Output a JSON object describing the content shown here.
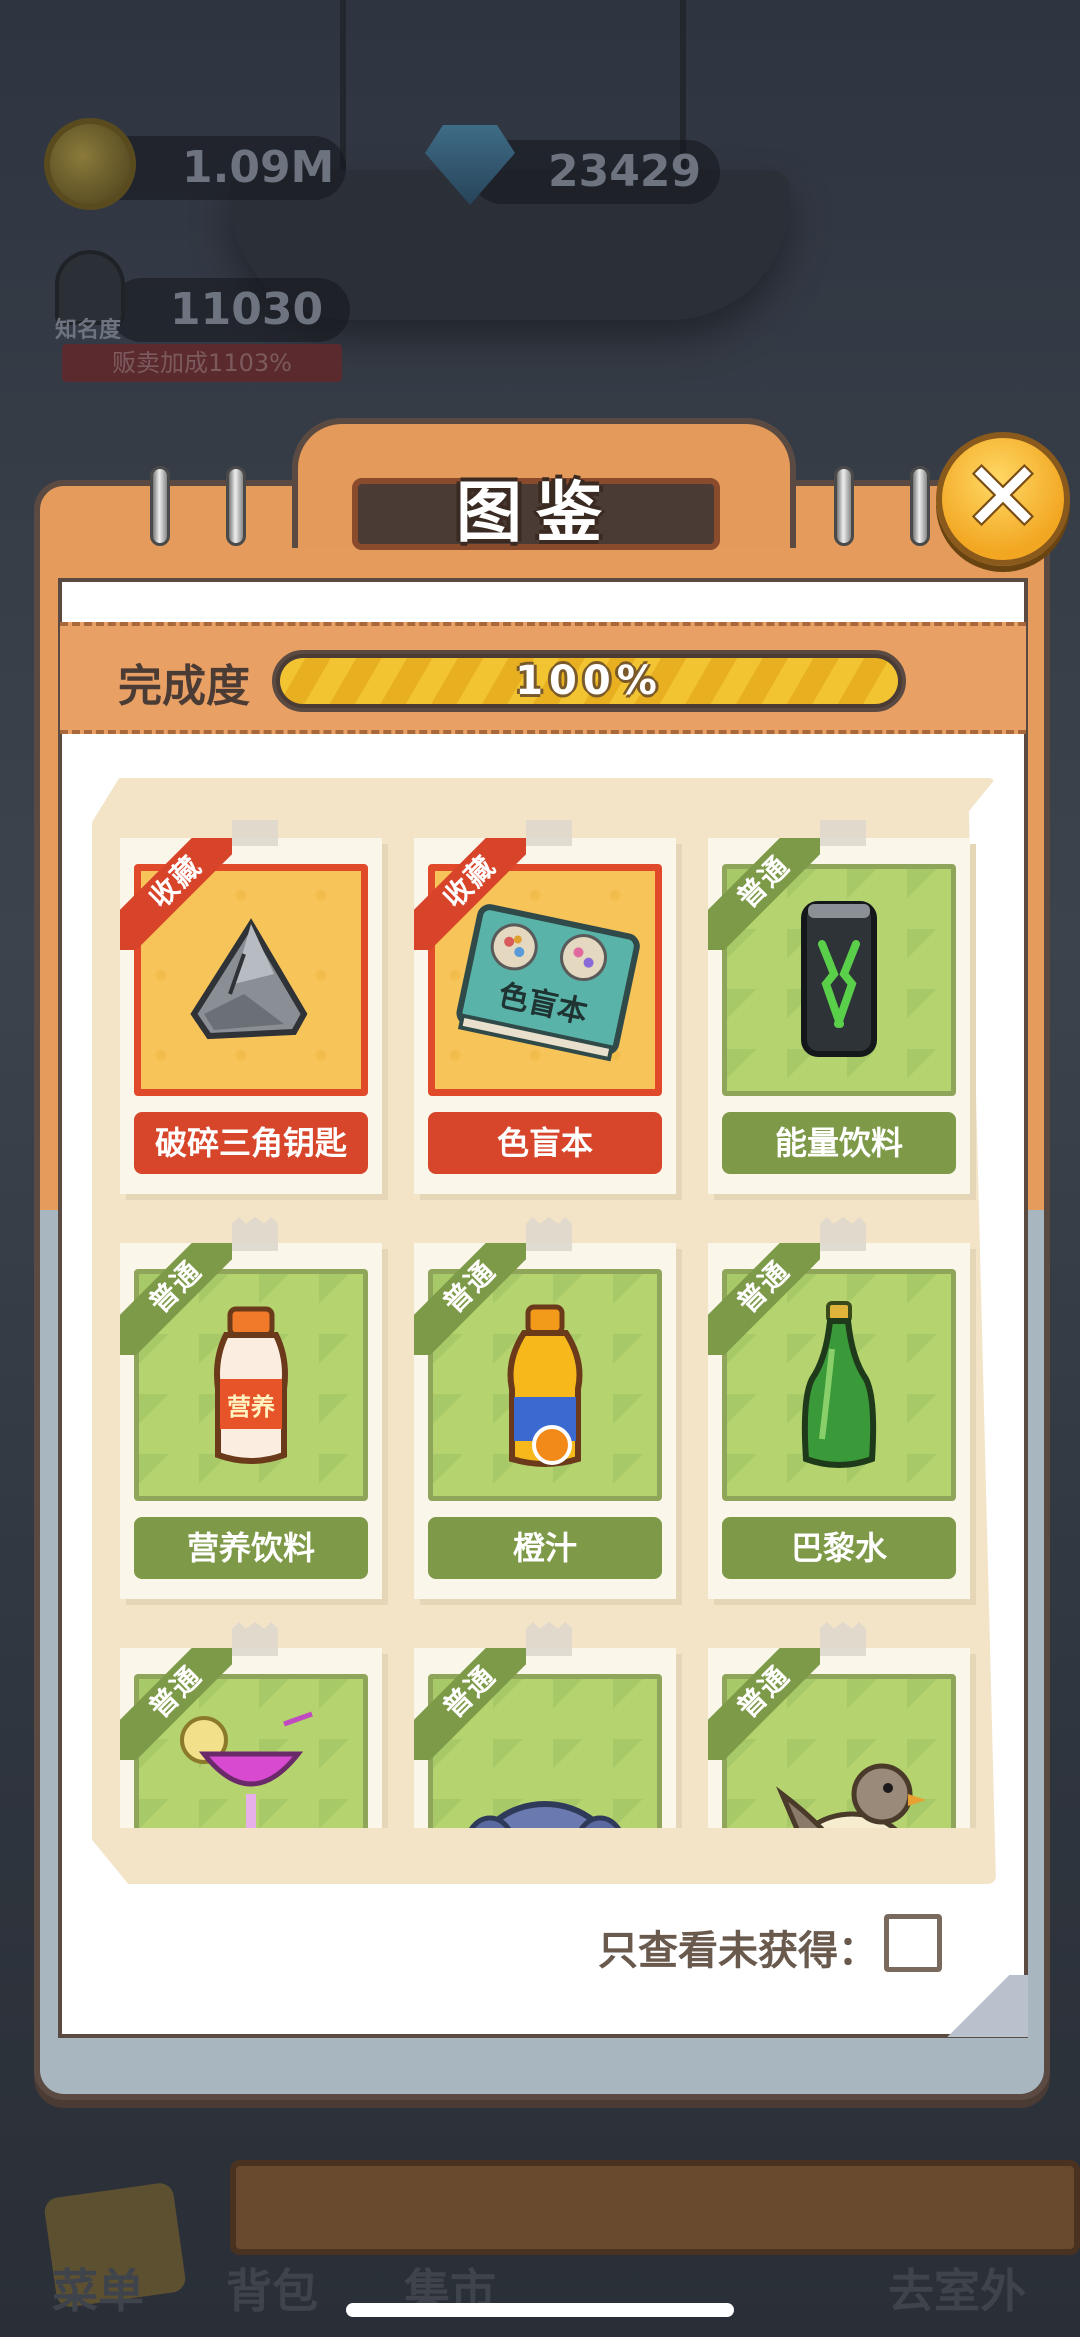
{
  "hud": {
    "coins": "1.09M",
    "gems": "23429",
    "fame_label": "知名度",
    "fame_value": "11030",
    "sales_bonus": "贩卖加成1103%"
  },
  "bottom_nav": {
    "menu": "菜单",
    "bag": "背包",
    "market": "集市",
    "outdoor": "去室外"
  },
  "codex": {
    "title": "图鉴",
    "close_icon": "close-x-icon",
    "progress_label": "完成度",
    "progress_percent": 100,
    "progress_text": "100%",
    "filter_label": "只查看未获得：",
    "filter_checked": false,
    "rarity_labels": {
      "collect": "收藏",
      "normal": "普通"
    },
    "items": [
      {
        "name": "破碎三角钥匙",
        "rarity": "collect",
        "icon": "broken-triangle-key-icon"
      },
      {
        "name": "色盲本",
        "rarity": "collect",
        "icon": "colorblind-book-icon",
        "icon_text": "色盲本"
      },
      {
        "name": "能量饮料",
        "rarity": "normal",
        "icon": "energy-drink-can-icon"
      },
      {
        "name": "营养饮料",
        "rarity": "normal",
        "icon": "nutrition-drink-bottle-icon",
        "icon_text": "营养"
      },
      {
        "name": "橙汁",
        "rarity": "normal",
        "icon": "orange-juice-bottle-icon"
      },
      {
        "name": "巴黎水",
        "rarity": "normal",
        "icon": "sparkling-water-bottle-icon"
      },
      {
        "name": "",
        "rarity": "normal",
        "icon": "cocktail-glass-icon"
      },
      {
        "name": "",
        "rarity": "normal",
        "icon": "elephant-icon"
      },
      {
        "name": "",
        "rarity": "normal",
        "icon": "sparrow-bird-icon"
      }
    ]
  }
}
